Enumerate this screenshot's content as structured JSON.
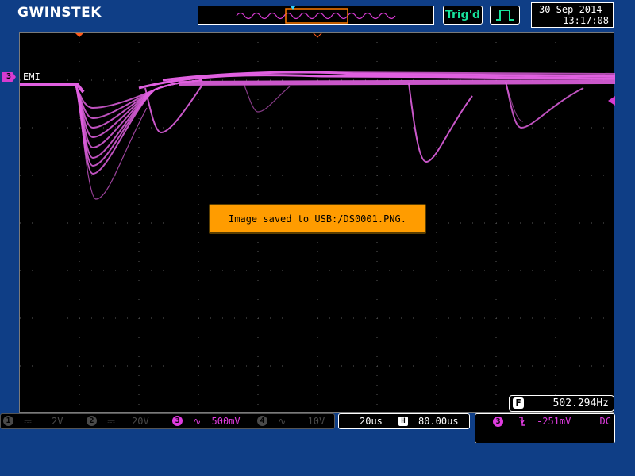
{
  "header": {
    "brand": "GWINSTEK",
    "trigger_status": "Trig'd",
    "date": "30 Sep 2014",
    "time": "13:17:08"
  },
  "waveform": {
    "channel_number": "3",
    "channel_label": "EMI",
    "trace_color": "#e060e0"
  },
  "notice": {
    "message": "Image saved to USB:/DS0001.PNG."
  },
  "frequency": {
    "icon": "F",
    "value": "502.294Hz"
  },
  "channels": [
    {
      "number": "1",
      "coupling_icon": "dc-coupling-icon",
      "scale": "2V",
      "active": false
    },
    {
      "number": "2",
      "coupling_icon": "dc-coupling-icon",
      "scale": "20V",
      "active": false
    },
    {
      "number": "3",
      "coupling_icon": "ac-coupling-icon",
      "scale": "500mV",
      "active": true
    },
    {
      "number": "4",
      "coupling_icon": "ac-coupling-icon",
      "scale": "10V",
      "active": false
    }
  ],
  "timebase": {
    "scale": "20us",
    "position_icon": "H",
    "position": "80.00us"
  },
  "trigger": {
    "source": "3",
    "slope_icon": "falling-edge-icon",
    "level": "-251mV",
    "coupling": "DC"
  },
  "colors": {
    "background": "#0f3e86",
    "ch3": "#e03ce0",
    "trig_status": "#18e29c",
    "notice": "#ff9c00"
  }
}
